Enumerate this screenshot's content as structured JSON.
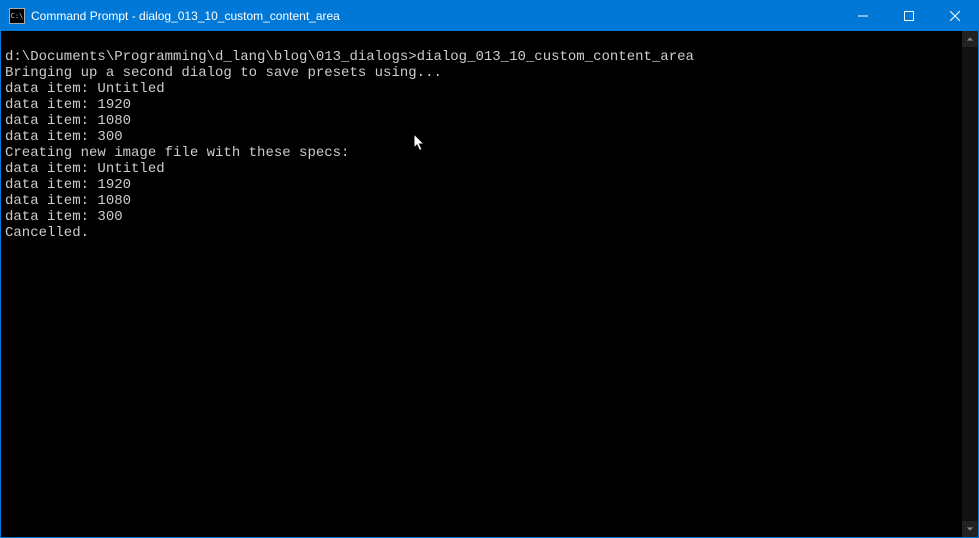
{
  "titlebar": {
    "icon_text": "C:\\",
    "title": "Command Prompt - dialog_013_10_custom_content_area"
  },
  "terminal": {
    "prompt": "d:\\Documents\\Programming\\d_lang\\blog\\013_dialogs>",
    "command": "dialog_013_10_custom_content_area",
    "lines": [
      "Bringing up a second dialog to save presets using...",
      "data item: Untitled",
      "data item: 1920",
      "data item: 1080",
      "data item: 300",
      "Creating new image file with these specs:",
      "data item: Untitled",
      "data item: 1920",
      "data item: 1080",
      "data item: 300",
      "Cancelled."
    ]
  }
}
